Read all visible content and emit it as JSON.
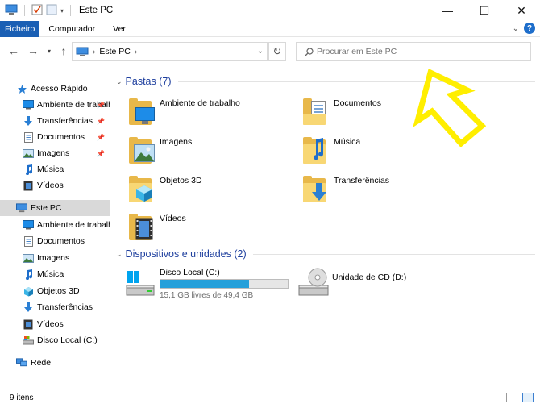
{
  "window": {
    "title": "Este PC",
    "controls": {
      "minimize": "—",
      "maximize": "☐",
      "close": "✕"
    }
  },
  "ribbon": {
    "tabs": [
      "Ficheiro",
      "Computador",
      "Ver"
    ],
    "help": "?"
  },
  "nav": {
    "address": "Este PC",
    "search_placeholder": "Procurar em Este PC"
  },
  "sidebar": {
    "quick_access": "Acesso Rápido",
    "quick_items": [
      "Ambiente de trabalho",
      "Transferências",
      "Documentos",
      "Imagens",
      "Música",
      "Vídeos"
    ],
    "this_pc": "Este PC",
    "pc_items": [
      "Ambiente de trabalho",
      "Documentos",
      "Imagens",
      "Música",
      "Objetos 3D",
      "Transferências",
      "Vídeos",
      "Disco Local (C:)"
    ],
    "network": "Rede"
  },
  "main": {
    "folders_header": "Pastas (7)",
    "folders": [
      "Ambiente de trabalho",
      "Documentos",
      "Imagens",
      "Música",
      "Objetos 3D",
      "Transferências",
      "Vídeos"
    ],
    "devices_header": "Dispositivos e unidades (2)",
    "drives": [
      {
        "name": "Disco Local (C:)",
        "free": "15,1 GB livres de 49,4 GB",
        "used_fraction": 0.694
      },
      {
        "name": "Unidade de CD (D:)"
      }
    ]
  },
  "status": {
    "item_count": "9 itens"
  },
  "colors": {
    "accent": "#1a5fb4",
    "folder": "#f8d774",
    "drive_bar": "#26a0da",
    "annotation": "#ffee00"
  }
}
